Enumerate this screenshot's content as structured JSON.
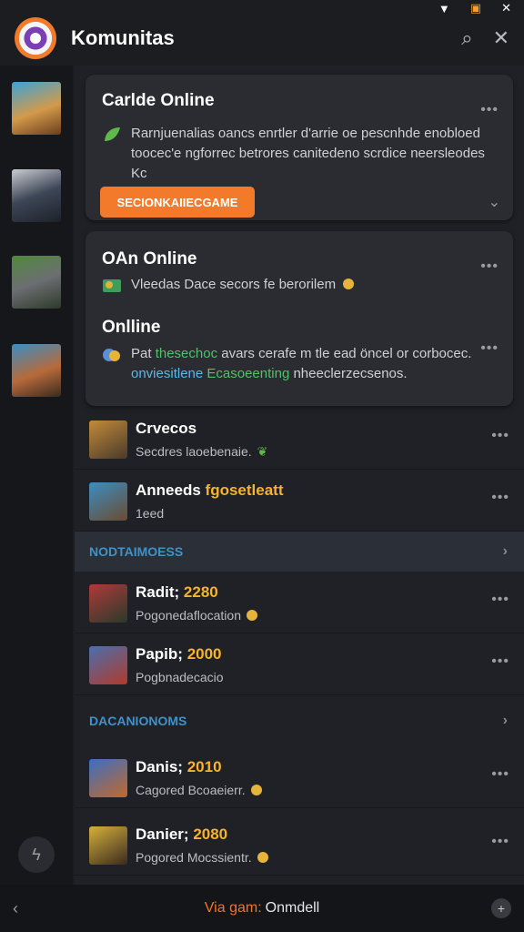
{
  "status": {
    "wifi_icon": "wifi-icon",
    "battery_icon": "battery-icon",
    "close_icon": "close-icon"
  },
  "header": {
    "title": "Komunitas",
    "search_icon": "search-icon",
    "close_icon": "close-icon"
  },
  "cards": [
    {
      "title": "Carlde Online",
      "text": "Rarnjuenalias oancs enrtler d'arrie oe pescnhde enobloed toocec'e ngforrec betrores canitedeno scrdice neersleodes Kc",
      "button_label": "SECIONKAIIECGAME"
    },
    {
      "title": "OAn Online",
      "text": "Vleedas Dace secors fe berorilem"
    },
    {
      "title": "Onlline",
      "text_plain": "Pat",
      "text_green": "thesechoc",
      "text_tail": "avars cerafe m tle ead öncel or corbocec.",
      "text_line2a": "onviesitlene",
      "text_line2b": "Ecasoeenting",
      "text_line2c": "nheeclerzecsenos."
    }
  ],
  "rows_top": [
    {
      "title": "Crvecos",
      "subtitle": "Secdres laoebenaie."
    },
    {
      "title": "Anneeds",
      "title_hl": "fgosetleatt",
      "subtitle": "1eed"
    }
  ],
  "section_1": {
    "label": "NODTAIMOESS"
  },
  "rows_mid": [
    {
      "title": "Radit;",
      "title_hl": "2280",
      "subtitle": "Pogonedaflocation"
    },
    {
      "title": "Papib;",
      "title_hl": "2000",
      "subtitle": "Pogbnadecacio"
    }
  ],
  "section_2": {
    "label": "DACANIONOMS"
  },
  "rows_bottom": [
    {
      "title": "Danis;",
      "title_hl": "2010",
      "subtitle": "Cagored Bcoaeierr."
    },
    {
      "title": "Danier;",
      "title_hl": "2080",
      "subtitle": "Pogored Mocssientr."
    }
  ],
  "bottom_bar": {
    "label_a": "Via gam:",
    "label_b": "Onmdell"
  },
  "colors": {
    "accent": "#f47a2b",
    "highlight": "#f6b32c",
    "section": "#3f92c8",
    "background": "#1c1d21"
  }
}
